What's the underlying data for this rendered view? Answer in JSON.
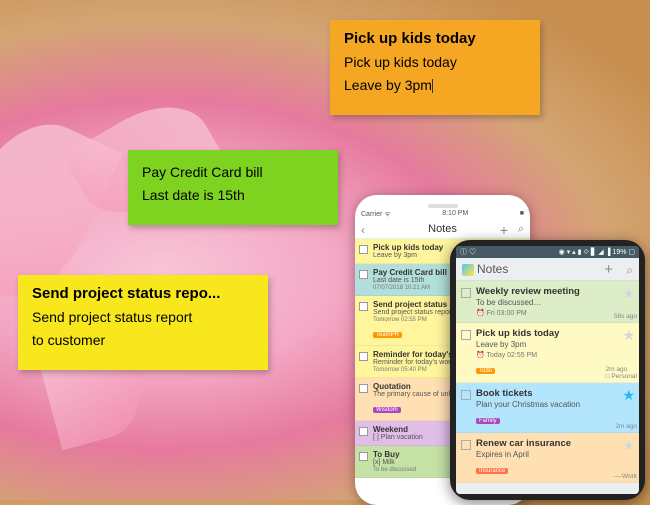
{
  "stickies": {
    "orange": {
      "title": "Pick up kids today",
      "line1": "Pick up kids today",
      "line2": "Leave by 3pm"
    },
    "green": {
      "line1": "Pay Credit Card bill",
      "line2": "Last date is 15th"
    },
    "yellow": {
      "title": "Send project status repo...",
      "line1": "Send project status report",
      "line2": "to customer"
    }
  },
  "iphone": {
    "status": {
      "carrier": "Carrier",
      "wifi": "ᯤ",
      "time": "8:10 PM",
      "batt": "■"
    },
    "header": {
      "back": "‹",
      "title": "Notes",
      "plus": "+",
      "search": "⌕"
    },
    "rows": [
      {
        "title": "Pick up kids today",
        "sub": "Leave by 3pm",
        "bg": "#fff59d"
      },
      {
        "title": "Pay Credit Card bill",
        "sub": "Last date is 15th",
        "meta": "07/07/2018 10:21 AM",
        "bg": "#b2dfdb"
      },
      {
        "title": "Send project status repo…",
        "sub": "Send project status report to cu…",
        "meta": "Tomorrow 02:55 PM",
        "bg": "#fff59d",
        "tag": "TeamPR",
        "tagbg": "#ff9800"
      },
      {
        "title": "Reminder for today's workou",
        "sub": "Reminder for today's workout & …",
        "meta": "Tomorrow 05:40 PM",
        "bg": "#fff59d"
      },
      {
        "title": "Quotation",
        "sub": "The primary cause of unhappine…",
        "bg": "#ffe0b2",
        "tag": "Wisdom",
        "tagbg": "#ab47bc"
      },
      {
        "title": "Weekend",
        "sub": "[ ] Plan vacation",
        "bg": "#e1bee7"
      },
      {
        "title": "To Buy",
        "sub": "[x] Milk",
        "meta": "To be discussed",
        "bg": "#c5e1a5"
      }
    ]
  },
  "android": {
    "status": {
      "left": "ⓘ  ♡",
      "right": "◉ ▾ ▴ ▮ ⟐ ▋ ◢ ▐ 19% ▢"
    },
    "header": {
      "title": "Notes",
      "plus": "+",
      "search": "⌕"
    },
    "rows": [
      {
        "title": "Weekly review meeting",
        "sub": "To be discussed…",
        "meta": "⏰ Fri 03:00 PM",
        "rmeta": "58s ago",
        "bg": "#dcedc8"
      },
      {
        "title": "Pick up kids today",
        "sub": "Leave by 3pm",
        "meta": "⏰ Today 02:55 PM",
        "rmeta": "2m ago",
        "rmeta2": "□ Personal",
        "bg": "#fff9c4",
        "tag": "Todo",
        "tagbg": "#ff9800"
      },
      {
        "title": "Book tickets",
        "sub": "Plan your Christmas vacation",
        "rmeta": "2m ago",
        "bg": "#b3e5fc",
        "tag": "Family",
        "tagbg": "#ab47bc",
        "star": true
      },
      {
        "title": "Renew car insurance",
        "sub": "Expires in April",
        "rmeta": "----Work",
        "bg": "#ffe0b2",
        "tag": "Insurance",
        "tagbg": "#ff7043"
      }
    ]
  }
}
